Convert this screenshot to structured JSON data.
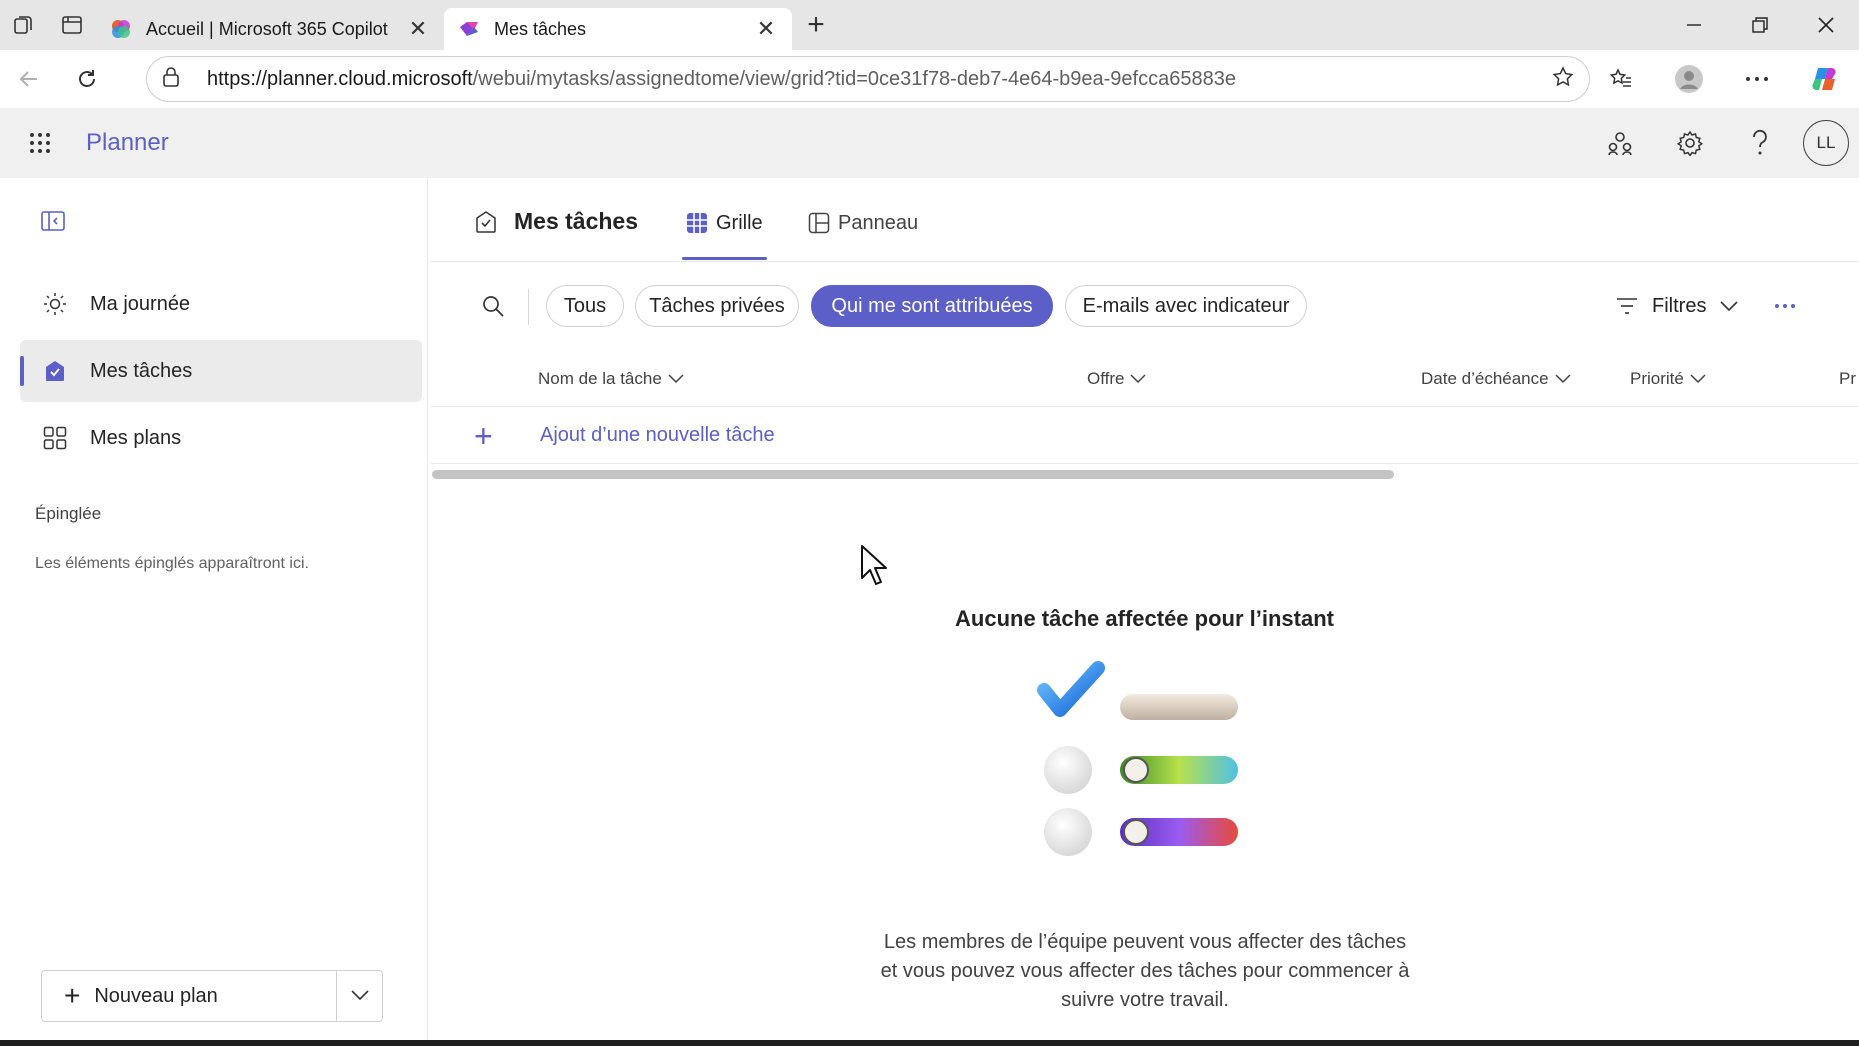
{
  "browser": {
    "tabs": [
      {
        "title": "Accueil | Microsoft 365 Copilot",
        "active": false
      },
      {
        "title": "Mes tâches",
        "active": true
      }
    ],
    "url_domain": "https://planner.cloud.microsoft",
    "url_path": "/webui/mytasks/assignedtome/view/grid?tid=0ce31f78-deb7-4e64-b9ea-9efcca65883e"
  },
  "app": {
    "name": "Planner",
    "avatar_initials": "LL"
  },
  "sidebar": {
    "items": [
      {
        "label": "Ma journée",
        "icon": "sun-icon",
        "selected": false
      },
      {
        "label": "Mes tâches",
        "icon": "my-tasks-icon",
        "selected": true
      },
      {
        "label": "Mes plans",
        "icon": "plans-grid-icon",
        "selected": false
      }
    ],
    "pinned_heading": "Épinglée",
    "pinned_empty": "Les éléments épinglés apparaîtront ici.",
    "new_plan_label": "Nouveau plan"
  },
  "main": {
    "title": "Mes tâches",
    "view_tabs": [
      {
        "label": "Grille",
        "active": true
      },
      {
        "label": "Panneau",
        "active": false
      }
    ],
    "filter_pills": [
      {
        "label": "Tous",
        "selected": false
      },
      {
        "label": "Tâches privées",
        "selected": false
      },
      {
        "label": "Qui me sont attribuées",
        "selected": true
      },
      {
        "label": "E-mails avec indicateur",
        "selected": false
      }
    ],
    "filters_label": "Filtres",
    "columns": [
      "Nom de la tâche",
      "Offre",
      "Date d’échéance",
      "Priorité",
      "Pr"
    ],
    "add_task_label": "Ajout d’une nouvelle tâche",
    "empty_title": "Aucune tâche affectée pour l’instant",
    "empty_desc_lines": [
      "Les membres de l’équipe peuvent vous affecter des tâches",
      "et vous pouvez vous affecter des tâches pour commencer à",
      "suivre votre travail."
    ]
  },
  "colors": {
    "accent": "#5b5fc7",
    "header_bg": "#f0f0f0",
    "tabbar_bg": "#e6e6e6"
  }
}
